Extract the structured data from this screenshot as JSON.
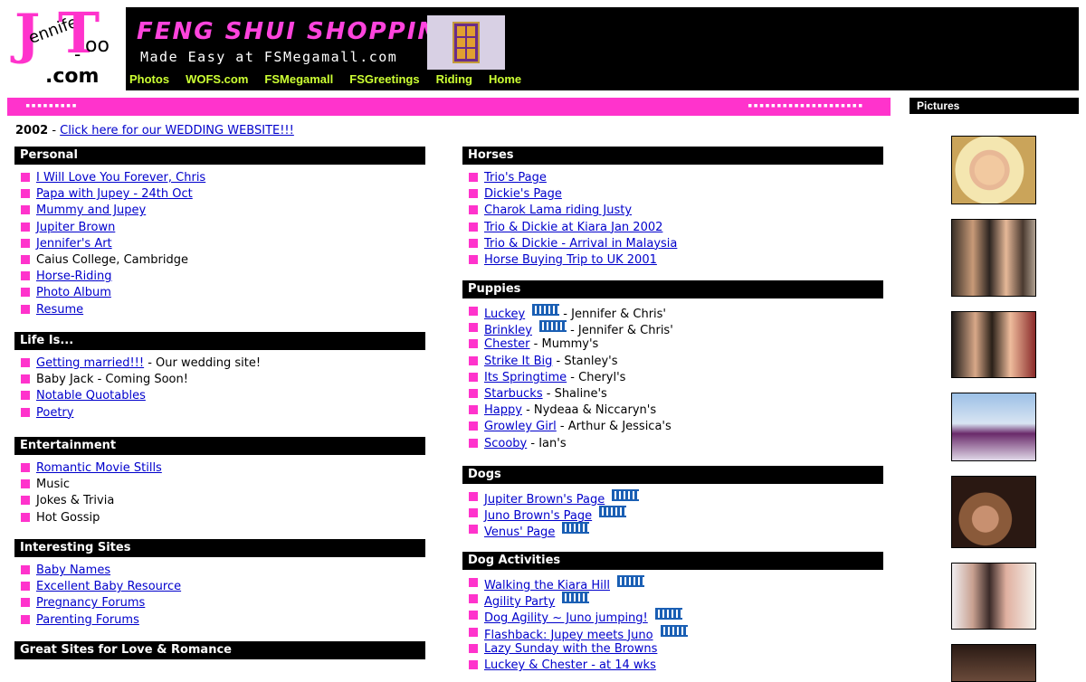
{
  "logo": {
    "j": "J",
    "t": "T",
    "nnifer": "ennifer",
    "oo": "oo",
    "dash": "-",
    "dotcom": ".com"
  },
  "banner": {
    "title": "FENG SHUI SHOPPING",
    "subtitle": "Made Easy at FSMegamall.com",
    "nav": [
      "Photos",
      "WOFS.com",
      "FSMegamall",
      "FSGreetings",
      "Riding",
      "Home"
    ]
  },
  "pinkbar": {
    "left": "▪▪▪▪▪▪▪▪▪",
    "right": "▪▪▪▪▪▪▪▪▪▪▪▪▪▪▪▪▪▪▪▪"
  },
  "pictures_title": "Pictures",
  "year": {
    "label": "2002",
    "sep": " - ",
    "link": "Click here for our WEDDING WEBSITE!!!"
  },
  "colors": {
    "pink": "#ff33cc",
    "link": "#0000cc",
    "nav": "#ccff33",
    "black": "#000000"
  },
  "left": {
    "personal": {
      "title": "Personal",
      "items": [
        {
          "link": "I Will Love You Forever, Chris"
        },
        {
          "link": "Papa with Jupey - 24th Oct"
        },
        {
          "link": "Mummy and Jupey"
        },
        {
          "link": "Jupiter Brown"
        },
        {
          "link": "Jennifer's Art"
        },
        {
          "text": "Caius College, Cambridge"
        },
        {
          "link": "Horse-Riding"
        },
        {
          "link": "Photo Album"
        },
        {
          "link": "Resume"
        }
      ]
    },
    "life": {
      "title": "Life Is...",
      "items": [
        {
          "link": "Getting married!!!",
          "text": " - Our wedding site!"
        },
        {
          "text": "Baby Jack - Coming Soon!"
        },
        {
          "link": "Notable Quotables"
        },
        {
          "link": "Poetry"
        }
      ]
    },
    "entertainment": {
      "title": "Entertainment",
      "items": [
        {
          "link": "Romantic Movie Stills"
        },
        {
          "text": "Music"
        },
        {
          "text": "Jokes & Trivia"
        },
        {
          "text": "Hot Gossip"
        }
      ]
    },
    "interesting": {
      "title": "Interesting Sites",
      "items": [
        {
          "link": "Baby Names"
        },
        {
          "link": "Excellent Baby Resource"
        },
        {
          "link": "Pregnancy Forums"
        },
        {
          "link": "Parenting Forums"
        }
      ]
    },
    "love": {
      "title": "Great Sites for Love & Romance"
    }
  },
  "right": {
    "horses": {
      "title": "Horses",
      "items": [
        {
          "link": "Trio's Page"
        },
        {
          "link": "Dickie's Page"
        },
        {
          "link": "Charok Lama riding Justy"
        },
        {
          "link": "Trio & Dickie at Kiara Jan 2002"
        },
        {
          "link": "Trio & Dickie - Arrival in Malaysia"
        },
        {
          "link": "Horse Buying Trip to UK 2001"
        }
      ]
    },
    "puppies": {
      "title": "Puppies",
      "items": [
        {
          "link": "Luckey",
          "new": true,
          "text": " - Jennifer & Chris'"
        },
        {
          "link": "Brinkley",
          "new": true,
          "text": " - Jennifer & Chris'"
        },
        {
          "link": "Chester",
          "text": " - Mummy's"
        },
        {
          "link": "Strike It Big",
          "text": " - Stanley's"
        },
        {
          "link": "Its Springtime",
          "text": " - Cheryl's"
        },
        {
          "link": "Starbucks",
          "text": " - Shaline's"
        },
        {
          "link": "Happy",
          "text": " - Nydeaa & Niccaryn's"
        },
        {
          "link": "Growley Girl",
          "text": " - Arthur & Jessica's"
        },
        {
          "link": "Scooby",
          "text": " - Ian's"
        }
      ]
    },
    "dogs": {
      "title": "Dogs",
      "items": [
        {
          "link": "Jupiter Brown's Page",
          "new": true
        },
        {
          "link": "Juno Brown's Page",
          "new": true
        },
        {
          "link": "Venus' Page",
          "new": true
        }
      ]
    },
    "activities": {
      "title": "Dog Activities",
      "items": [
        {
          "link": "Walking the Kiara Hill",
          "new": true
        },
        {
          "link": "Agility Party",
          "new": true
        },
        {
          "link": "Dog Agility ~ Juno jumping!",
          "new": true
        },
        {
          "link": "Flashback: Jupey meets Juno",
          "new": true
        },
        {
          "link": "Lazy Sunday with the Browns"
        },
        {
          "link": "Luckey & Chester - at 14 wks"
        }
      ]
    }
  }
}
